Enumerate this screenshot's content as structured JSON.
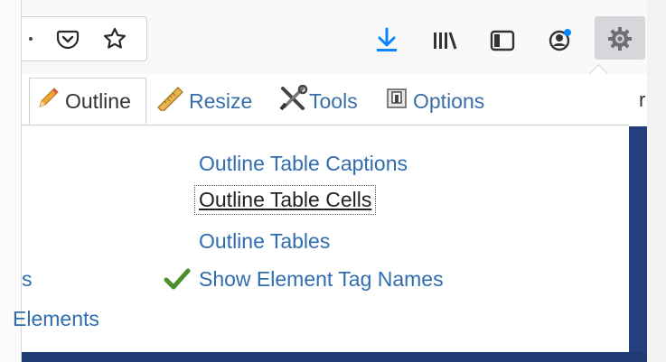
{
  "toolbar": {
    "icons": [
      "dot-icon",
      "pocket-icon",
      "star-icon",
      "download-icon",
      "library-icon",
      "sidebar-icon",
      "account-icon",
      "gear-icon"
    ],
    "accent_color": "#0a84ff"
  },
  "tabs": [
    {
      "label": "Outline",
      "icon": "pencil-icon",
      "active": true
    },
    {
      "label": "Resize",
      "icon": "ruler-icon",
      "active": false
    },
    {
      "label": "Tools",
      "icon": "tools-icon",
      "active": false
    },
    {
      "label": "Options",
      "icon": "options-icon",
      "active": false
    }
  ],
  "cut_text": "r",
  "menu": {
    "items": [
      {
        "label": "Outline Table Captions"
      },
      {
        "label": "Outline Table Cells",
        "focused": true
      },
      {
        "label": "Outline Tables"
      },
      {
        "label": "Show Element Tag Names",
        "checked": true
      }
    ]
  },
  "left_items": [
    {
      "label": "s"
    },
    {
      "label": "Elements"
    }
  ]
}
